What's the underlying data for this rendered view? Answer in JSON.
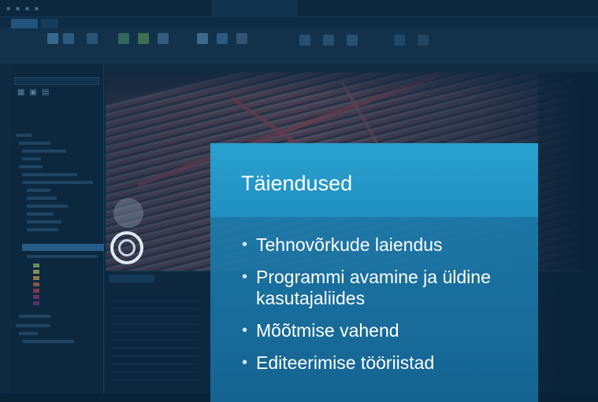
{
  "panel": {
    "title": "Täiendused",
    "bullets": [
      "Tehnovõrkude laiendus",
      "Programmi avamine ja üldine kasutajaliides",
      "Mõõtmise vahend",
      "Editeerimise tööriistad"
    ]
  },
  "colors": {
    "title_band": "#2aa2cf",
    "body_band": "#1c7eb0",
    "background_tint": "#123045"
  },
  "icons": [
    "compass-navigator-icon"
  ]
}
